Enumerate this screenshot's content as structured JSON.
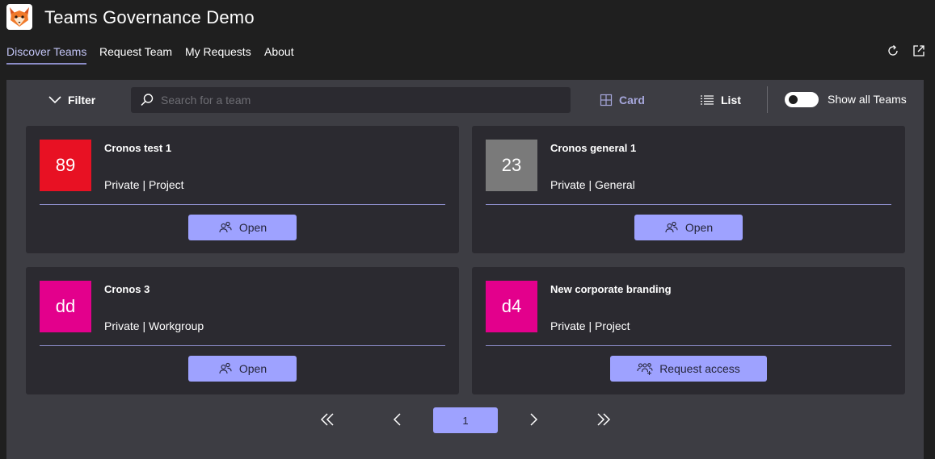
{
  "app": {
    "title": "Teams Governance Demo"
  },
  "tabs": [
    {
      "label": "Discover Teams",
      "active": true
    },
    {
      "label": "Request Team",
      "active": false
    },
    {
      "label": "My Requests",
      "active": false
    },
    {
      "label": "About",
      "active": false
    }
  ],
  "toolbar": {
    "filter_label": "Filter",
    "search_placeholder": "Search for a team",
    "search_value": "",
    "view_card_label": "Card",
    "view_list_label": "List",
    "active_view": "Card",
    "show_all_label": "Show all Teams",
    "show_all_on": false
  },
  "teams": [
    {
      "initials": "89",
      "name": "Cronos test 1",
      "meta": "Private | Project",
      "avatar_color": "#e81123",
      "action": "Open"
    },
    {
      "initials": "23",
      "name": "Cronos general 1",
      "meta": "Private | General",
      "avatar_color": "#7a7a7a",
      "action": "Open"
    },
    {
      "initials": "dd",
      "name": "Cronos 3",
      "meta": "Private | Workgroup",
      "avatar_color": "#e3008c",
      "action": "Open"
    },
    {
      "initials": "d4",
      "name": "New corporate branding",
      "meta": "Private | Project",
      "avatar_color": "#e3008c",
      "action": "Request access"
    }
  ],
  "pagination": {
    "current_page": "1"
  },
  "colors": {
    "accent": "#9ea2ff",
    "active_tab": "#c3c5f6",
    "panel": "#3d3d43",
    "card": "#2b2a30"
  }
}
